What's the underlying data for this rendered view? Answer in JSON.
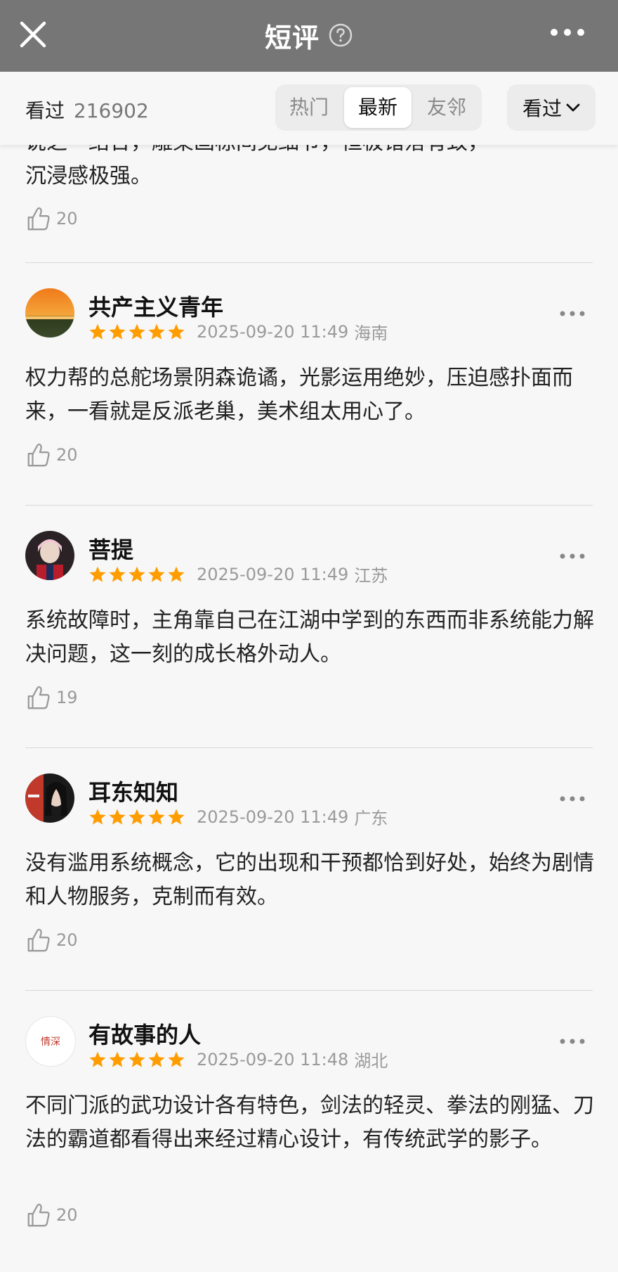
{
  "header": {
    "title": "短评"
  },
  "subbar": {
    "watched_label": "看过",
    "watched_count": "216902",
    "tabs": [
      {
        "label": "热门",
        "active": false
      },
      {
        "label": "最新",
        "active": true
      },
      {
        "label": "友邻",
        "active": false
      }
    ],
    "filter_label": "看过"
  },
  "partial_review": {
    "line1": "说之一结合，雕梁画栋间见细节，恒极错落有致，",
    "line2": "沉浸感极强。",
    "likes": "20"
  },
  "reviews": [
    {
      "username": "共产主义青年",
      "rating": 5,
      "date": "2025-09-20 11:49",
      "location": "海南",
      "text": "权力帮的总舵场景阴森诡谲，光影运用绝妙，压迫感扑面而来，一看就是反派老巢，美术组太用心了。",
      "likes": "20"
    },
    {
      "username": "菩提",
      "rating": 5,
      "date": "2025-09-20 11:49",
      "location": "江苏",
      "text": "系统故障时，主角靠自己在江湖中学到的东西而非系统能力解决问题，这一刻的成长格外动人。",
      "likes": "19"
    },
    {
      "username": "耳东知知",
      "rating": 5,
      "date": "2025-09-20 11:49",
      "location": "广东",
      "text": "没有滥用系统概念，它的出现和干预都恰到好处，始终为剧情和人物服务，克制而有效。",
      "likes": "20"
    },
    {
      "username": "有故事的人",
      "avatar_text": "情深",
      "rating": 5,
      "date": "2025-09-20 11:48",
      "location": "湖北",
      "text": "不同门派的武功设计各有特色，剑法的轻灵、拳法的刚猛、刀法的霸道都看得出来经过精心设计，有传统武学的影子。",
      "likes": "20"
    }
  ],
  "colors": {
    "header_bg": "#767676",
    "star": "#ff9d00",
    "page_bg": "#f7f7f7"
  }
}
